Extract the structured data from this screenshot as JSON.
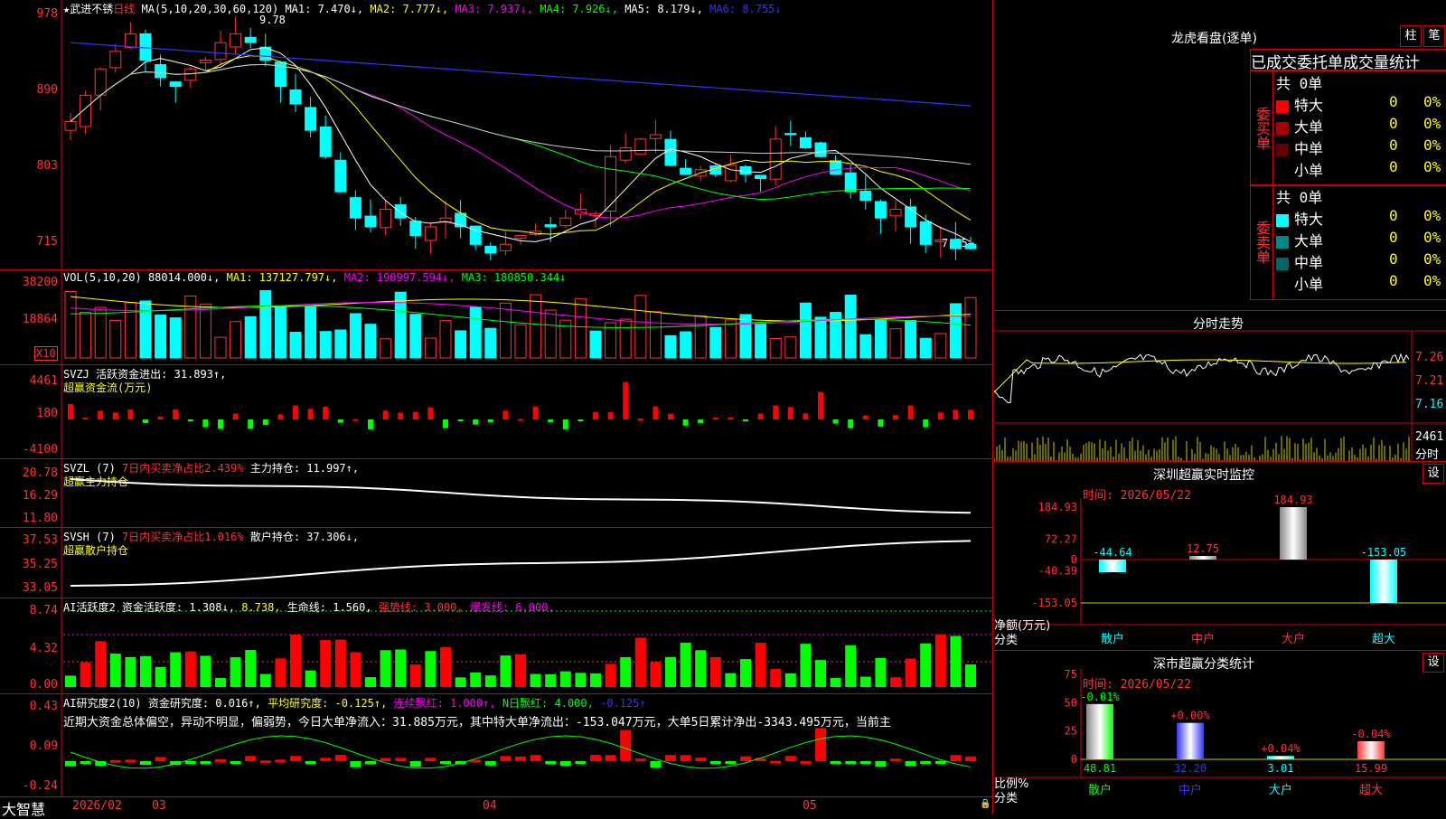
{
  "app": {
    "brand": "大智慧"
  },
  "price_panel": {
    "star": "★",
    "stock_name": "武进不锈",
    "period": "日线",
    "ma_label": "MA(5,10,20,30,60,120)",
    "ma1": "MA1: 7.470↓,",
    "ma2": "MA2: 7.777↓,",
    "ma3": "MA3: 7.937↓,",
    "ma4": "MA4: 7.926↓,",
    "ma5": "MA5: 8.179↓,",
    "ma6": "MA6: 8.755↓",
    "ylabels": [
      "978",
      "890",
      "803",
      "715"
    ],
    "high_marker": "9.78",
    "low_marker": "7.15→"
  },
  "vol_panel": {
    "label": "VOL(5,10,20)",
    "value": "88014.000↓,",
    "ma1": "MA1: 137127.797↓,",
    "ma2": "MA2: 190997.594↓,",
    "ma3": "MA3: 180850.344↓",
    "ylabels": [
      "38200",
      "18864"
    ],
    "unit": "X10"
  },
  "svzj_panel": {
    "label": "SVZJ",
    "desc": "活跃资金进出: 31.893↑,",
    "sub": "超赢资金流(万元)",
    "ylabels": [
      "4461",
      "180",
      "-4100"
    ]
  },
  "svzl_panel": {
    "label": "SVZL (7)",
    "desc": "7日内买卖净占比2.439%",
    "desc2": "主力持仓: 11.997↑,",
    "sub": "超赢主力持仓",
    "ylabels": [
      "20.78",
      "16.29",
      "11.80"
    ]
  },
  "svsh_panel": {
    "label": "SVSH (7)",
    "desc": "7日内买卖净占比1.016%",
    "desc2": "散户持仓: 37.306↓,",
    "sub": "超赢散户持仓",
    "ylabels": [
      "37.53",
      "35.25",
      "33.05"
    ]
  },
  "ai_active_panel": {
    "label": "AI活跃度2",
    "a": "资金活跃度: 1.308↓,",
    "b": "8.738,",
    "c": "生命线: 1.560,",
    "d": "强势线: 3.000,",
    "e": "爆发线: 6.000,",
    "ylabels": [
      "8.74",
      "4.32",
      "0.00"
    ]
  },
  "ai_research_panel": {
    "label": "AI研究度2(10)",
    "a": "资金研究度: 0.016↑,",
    "b": "平均研究度: -0.125↑,",
    "c": "连续飘红: 1.000↑,",
    "d": "N日飘红: 4.000,",
    "e": "-0.125↑",
    "comment": "近期大资金总体偏空，异动不明显，偏弱势，今日大单净流入：31.885万元，其中特大单净流出：-153.047万元，大单5日累计净出-3343.495万元，当前主",
    "ylabels": [
      "0.43",
      "0.09",
      "-0.24"
    ]
  },
  "time_axis": {
    "labels": [
      "2026/02",
      "03",
      "04",
      "05"
    ]
  },
  "dragon": {
    "title": "龙虎看盘(逐单)",
    "btn1": "柱",
    "btn2": "笔",
    "header": "已成交委托单成交量统计",
    "buy_label": "委买单",
    "sell_label": "委卖单",
    "buy_total": "共 0单",
    "sell_total": "共 0单",
    "buy_rows": [
      {
        "name": "特大",
        "count": "0",
        "pct": "0%",
        "color": "#ff0000"
      },
      {
        "name": "大单",
        "count": "0",
        "pct": "0%",
        "color": "#aa0000"
      },
      {
        "name": "中单",
        "count": "0",
        "pct": "0%",
        "color": "#660000"
      },
      {
        "name": "小单",
        "count": "0",
        "pct": "0%",
        "color": "#000000"
      }
    ],
    "sell_rows": [
      {
        "name": "特大",
        "count": "0",
        "pct": "0%",
        "color": "#00ffff"
      },
      {
        "name": "大单",
        "count": "0",
        "pct": "0%",
        "color": "#008888"
      },
      {
        "name": "中单",
        "count": "0",
        "pct": "0%",
        "color": "#006666"
      },
      {
        "name": "小单",
        "count": "0",
        "pct": "0%",
        "color": "#000000"
      }
    ]
  },
  "intraday": {
    "title": "分时走势",
    "ylabels": [
      "7.26",
      "7.21",
      "7.16"
    ],
    "vol_label": "2461",
    "unit": "分时"
  },
  "sz_monitor": {
    "title": "深圳超赢实时监控",
    "setting": "设",
    "time": "时间: 2026/05/22",
    "ylabels": [
      "184.93",
      "72.27",
      "0",
      "-40.39",
      "-153.05"
    ],
    "axis_title": "净额(万元)",
    "axis_sub": "分类",
    "categories": [
      "散户",
      "中户",
      "大户",
      "超大"
    ],
    "values": [
      "-44.64",
      "12.75",
      "184.93",
      "-153.05"
    ]
  },
  "sz_class": {
    "title": "深市超赢分类统计",
    "setting": "设",
    "time": "时间: 2026/05/22",
    "ylabels": [
      "75",
      "50",
      "25",
      "0"
    ],
    "axis_title": "比例%",
    "axis_sub": "分类",
    "categories": [
      "散户",
      "中户",
      "大户",
      "超大"
    ],
    "top_labels": [
      "-0.01%",
      "+0.00%",
      "+0.04%",
      "-0.04%"
    ],
    "values": [
      "48.81",
      "32.20",
      "3.01",
      "15.99"
    ]
  },
  "chart_data": [
    {
      "type": "bar",
      "title": "深圳超赢实时监控",
      "categories": [
        "散户",
        "中户",
        "大户",
        "超大"
      ],
      "values": [
        -44.64,
        12.75,
        184.93,
        -153.05
      ],
      "ylim": [
        -153.05,
        184.93
      ]
    },
    {
      "type": "bar",
      "title": "深市超赢分类统计",
      "categories": [
        "散户",
        "中户",
        "大户",
        "超大"
      ],
      "values": [
        48.81,
        32.2,
        3.01,
        15.99
      ],
      "ylim": [
        0,
        75
      ]
    }
  ]
}
